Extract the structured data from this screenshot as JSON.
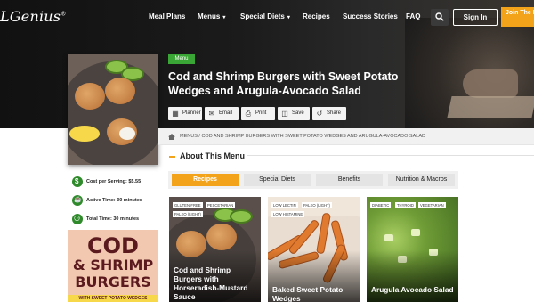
{
  "header": {
    "logo": "LGenius",
    "logo_mark": "®",
    "nav": [
      "Meal Plans",
      "Menus",
      "Special Diets",
      "Recipes",
      "Success Stories",
      "FAQ"
    ],
    "signin": "Sign In",
    "join": "Join The Planning"
  },
  "recipe": {
    "badge": "Menu",
    "title": "Cod and Shrimp Burgers with Sweet Potato Wedges and Arugula-Avocado Salad",
    "actions": [
      "Planner",
      "Email",
      "Print",
      "Save",
      "Share"
    ]
  },
  "breadcrumb": "MENUS / COD AND SHRIMP BURGERS WITH SWEET POTATO WEDGES AND ARUGULA-AVOCADO SALAD",
  "about": {
    "heading": "About This Menu",
    "tabs": [
      "Recipes",
      "Special Diets",
      "Benefits",
      "Nutrition & Macros"
    ],
    "active_tab": "Recipes"
  },
  "info": {
    "cost": "Cost per Serving: $5.55",
    "active": "Active Time: 30 minutes",
    "total": "Total Time: 30 minutes"
  },
  "poster": {
    "line1": "COD",
    "line2": "& SHRIMP",
    "line3": "BURGERS",
    "line4": "WITH SWEET POTATO WEDGES"
  },
  "cards": [
    {
      "tags": [
        "GLUTEN-FREE",
        "PESCETARIAN",
        "PALEO (LIGHT)"
      ],
      "title": "Cod and Shrimp Burgers with Horseradish-Mustard Sauce"
    },
    {
      "tags": [
        "LOW LECTIN",
        "PALEO (LIGHT)",
        "LOW HISTAMINE"
      ],
      "title": "Baked Sweet Potato Wedges"
    },
    {
      "tags": [
        "DIABETIC",
        "THYROID",
        "VEGETARIAN"
      ],
      "title": "Arugula Avocado Salad"
    }
  ],
  "colors": {
    "accent": "#f2a31a",
    "green": "#3aa635",
    "dark": "#111111"
  }
}
